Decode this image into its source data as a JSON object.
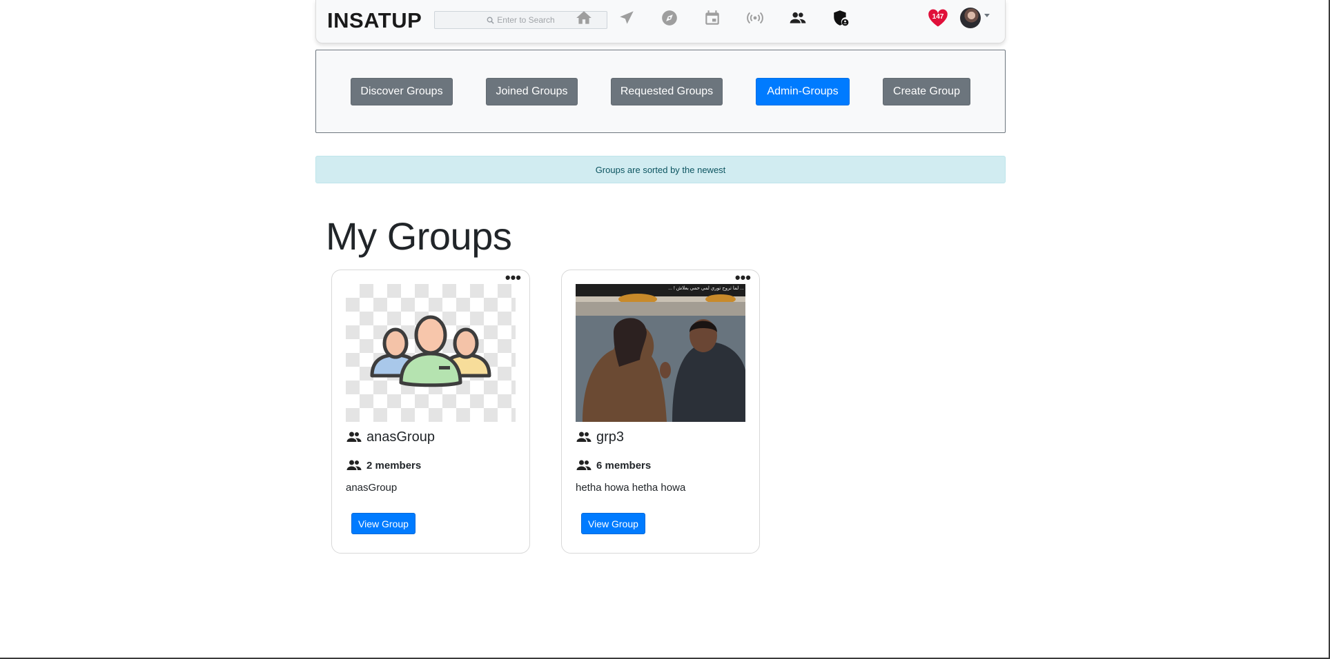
{
  "navbar": {
    "brand": "INSATUP",
    "search_placeholder": "Enter to Search",
    "icons": [
      "home-icon",
      "send-icon",
      "compass-icon",
      "calendar-icon",
      "live-broadcast-icon",
      "groups-icon",
      "admin-shield-icon",
      "notifications-heart-icon",
      "profile-avatar"
    ],
    "notification_count": "147"
  },
  "group_nav": {
    "discover": "Discover Groups",
    "joined": "Joined Groups",
    "requested": "Requested Groups",
    "admin": "Admin-Groups",
    "create": "Create Group",
    "active": "Admin-Groups"
  },
  "alert": {
    "text": "Groups are sorted by the newest"
  },
  "page_title": "My Groups",
  "groups": [
    {
      "name": "anasGroup",
      "members": "2 members",
      "description": "anasGroup",
      "button": "View Group",
      "menu": "•••"
    },
    {
      "name": "grp3",
      "members": "6 members",
      "description": "hetha howa hetha howa",
      "button": "View Group",
      "menu": "•••",
      "thumbnail_caption": "... ! لما تروح توري لمي حمي بعلاش ... "
    }
  ],
  "colors": {
    "primary": "#007bff",
    "secondary": "#6c757d",
    "alert_bg": "#d1ecf1",
    "heart": "#e0103a"
  }
}
